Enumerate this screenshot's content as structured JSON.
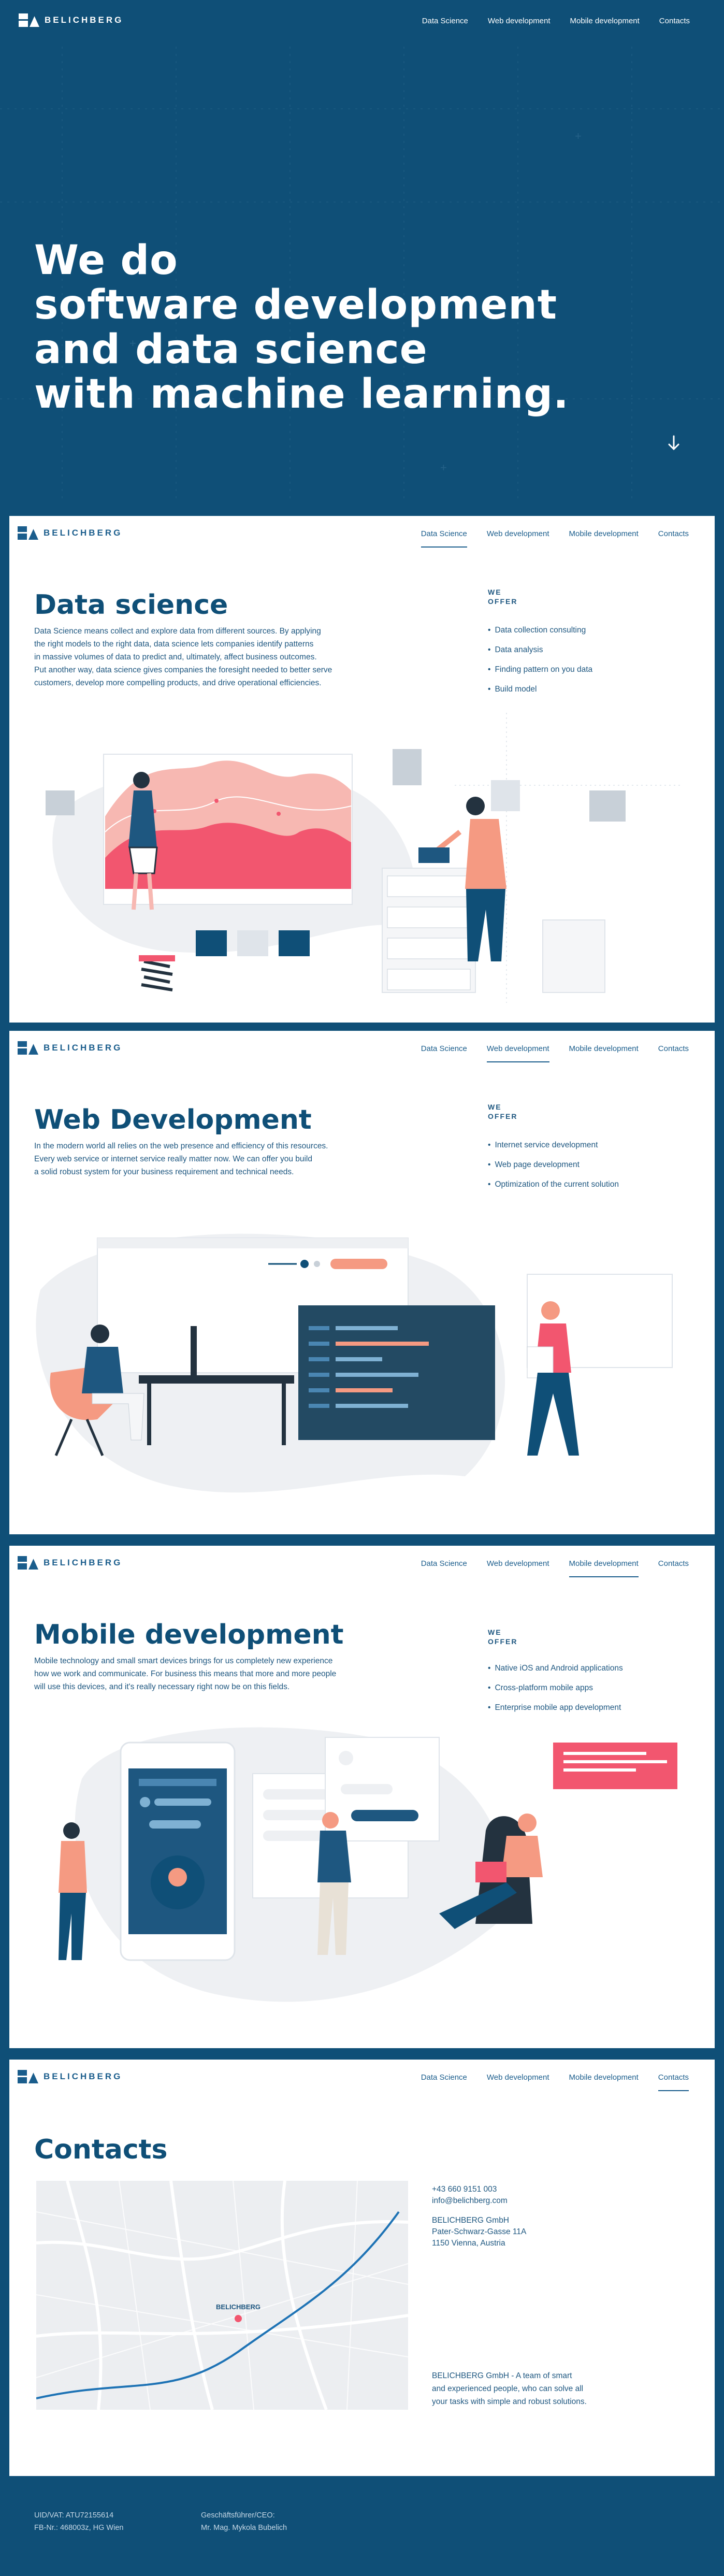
{
  "brand": {
    "name": "BELICHBERG"
  },
  "nav": {
    "items": [
      "Data Science",
      "Web development",
      "Mobile development",
      "Contacts"
    ]
  },
  "hero": {
    "lines": [
      "We do",
      "software development",
      "and data science",
      "with machine learning."
    ]
  },
  "icons": {
    "scroll": "arrow-down-icon",
    "logo": "belichberg-logo-icon"
  },
  "colors": {
    "brand_blue": "#0f4f77",
    "accent_pink": "#f2566f",
    "accent_salmon": "#f59a82",
    "dark_panel": "#234a63"
  },
  "data_science": {
    "active_nav": "Data Science",
    "title": "Data science",
    "body": [
      "Data Science means collect and explore data from different sources. By applying",
      "the right models to the right data, data science lets companies identify patterns",
      "in massive volumes of data to predict and, ultimately, affect business outcomes.",
      "Put another way, data science gives companies the foresight needed to better serve",
      "customers, develop more compelling products, and drive operational efficiencies."
    ],
    "offer_title": [
      "WE",
      "OFFER"
    ],
    "offers": [
      "Data collection consulting",
      "Data analysis",
      "Finding pattern on you data",
      "Build model"
    ]
  },
  "web_development": {
    "active_nav": "Web development",
    "title": "Web Development",
    "body": [
      "In the modern world all relies on the web presence and efficiency of this resources.",
      "Every web service or internet service really matter now. We can offer you build",
      "a solid robust system for your business requirement and technical needs."
    ],
    "offer_title": [
      "WE",
      "OFFER"
    ],
    "offers": [
      "Internet service development",
      "Web page development",
      "Optimization of the current solution"
    ]
  },
  "mobile_development": {
    "active_nav": "Mobile development",
    "title": "Mobile development",
    "body": [
      "Mobile technology and small smart devices brings for us completely new experience",
      "how we work and communicate. For business this means that more and more people",
      "will use this devices, and it's really necessary right now be on this fields."
    ],
    "offer_title": [
      "WE",
      "OFFER"
    ],
    "offers": [
      "Native iOS and Android applications",
      "Cross-platform mobile apps",
      "Enterprise mobile app development"
    ]
  },
  "contacts": {
    "active_nav": "Contacts",
    "title": "Contacts",
    "phone": "+43 660 9151 003",
    "email": "info@belichberg.com",
    "company": "BELICHBERG GmbH",
    "street": "Pater-Schwarz-Gasse 11A",
    "city": "1150 Vienna, Austria",
    "about": [
      "BELICHBERG GmbH - A team of smart",
      "and experienced people, who can solve all",
      "your tasks with simple and robust solutions."
    ],
    "map_label": "BELICHBERG"
  },
  "footer": {
    "col1": [
      "UID/VAT: ATU72155614",
      "FB-Nr.: 468003z, HG Wien"
    ],
    "col2": [
      "Geschäftsführer/CEO:",
      "Mr. Mag. Mykola Bubelich"
    ]
  }
}
